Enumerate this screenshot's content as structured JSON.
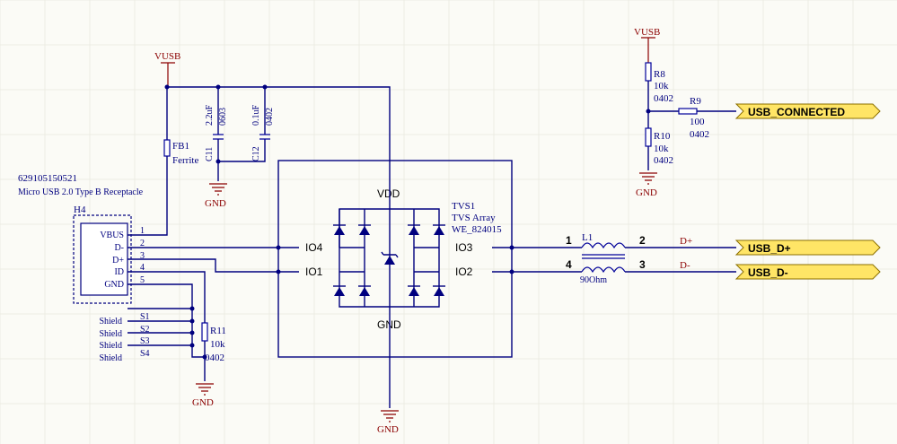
{
  "connector": {
    "part_number": "629105150521",
    "description": "Micro USB 2.0 Type B Receptacle",
    "designator": "H4",
    "pins": [
      {
        "name": "VBUS",
        "num": "1"
      },
      {
        "name": "D-",
        "num": "2"
      },
      {
        "name": "D+",
        "num": "3"
      },
      {
        "name": "ID",
        "num": "4"
      },
      {
        "name": "GND",
        "num": "5"
      }
    ],
    "shield_pins": [
      {
        "name": "Shield",
        "num": "S1"
      },
      {
        "name": "Shield",
        "num": "S2"
      },
      {
        "name": "Shield",
        "num": "S3"
      },
      {
        "name": "Shield",
        "num": "S4"
      }
    ]
  },
  "power": {
    "vusb_left": "VUSB",
    "vusb_right": "VUSB",
    "gnd_caps": "GND",
    "gnd_connector": "GND",
    "gnd_tvs": "GND",
    "gnd_divider": "GND"
  },
  "ferrite": {
    "designator": "FB1",
    "value": "Ferrite"
  },
  "c11": {
    "designator": "C11",
    "value": "2.2uF",
    "package": "0603"
  },
  "c12": {
    "designator": "C12",
    "value": "0.1uF",
    "package": "0402"
  },
  "tvs": {
    "designator": "TVS1",
    "value": "TVS Array",
    "part": "WE_824015",
    "pin_vdd": "VDD",
    "pin_gnd": "GND",
    "pin_io1": "IO1",
    "pin_io2": "IO2",
    "pin_io3": "IO3",
    "pin_io4": "IO4"
  },
  "choke": {
    "designator": "L1",
    "value": "90Ohm",
    "pin1": "1",
    "pin2": "2",
    "pin3": "3",
    "pin4": "4"
  },
  "r8": {
    "designator": "R8",
    "value": "10k",
    "package": "0402"
  },
  "r9": {
    "designator": "R9",
    "value": "100",
    "package": "0402"
  },
  "r10": {
    "designator": "R10",
    "value": "10k",
    "package": "0402"
  },
  "r11": {
    "designator": "R11",
    "value": "10k",
    "package": "0402"
  },
  "nets": {
    "dplus": "D+",
    "dminus": "D-",
    "usb_dplus_port": "USB_D+",
    "usb_dminus_port": "USB_D-",
    "usb_connected_port": "USB_CONNECTED"
  }
}
